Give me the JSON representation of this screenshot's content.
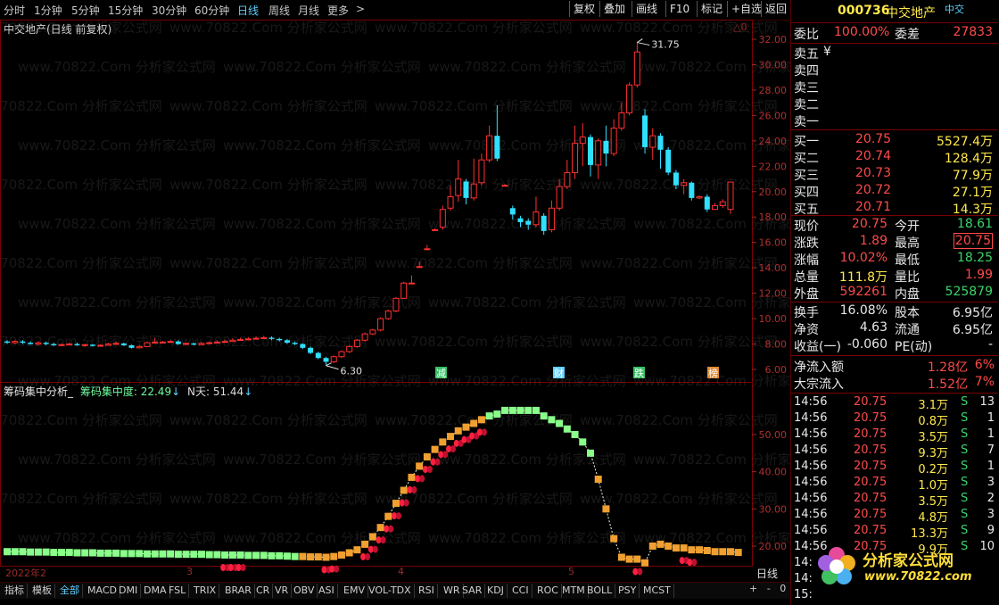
{
  "toolbar": {
    "periods": [
      "分时",
      "1分钟",
      "5分钟",
      "15分钟",
      "30分钟",
      "60分钟",
      "日线",
      "周线",
      "月线",
      "更多"
    ],
    "active_period": "日线",
    "more_arrow": ">",
    "buttons": [
      "复权",
      "叠加",
      "画线",
      "F10",
      "标记",
      "+自选",
      "返回"
    ]
  },
  "chart": {
    "title": "中交地产(日线 前复权)",
    "high_label": "31.75",
    "low_label": "6.30",
    "axis_ticks": [
      "32.00",
      "30.00",
      "28.00",
      "26.00",
      "24.00",
      "22.00",
      "20.00",
      "18.00",
      "16.00",
      "14.00",
      "12.00",
      "10.00",
      "8.00",
      "6.00"
    ],
    "events": [
      {
        "text": "减",
        "color": "#35c065"
      },
      {
        "text": "财",
        "color": "#5fd0ff"
      },
      {
        "text": "跌",
        "color": "#35c065"
      },
      {
        "text": "榜",
        "color": "#e08a30"
      }
    ],
    "top_right_mark": "△0",
    "watermark": "www.70822.Com 分析家公式网"
  },
  "indicator": {
    "name": "筹码集中分析_",
    "label1": "筹码集中度:",
    "value1": "22.49",
    "label2": "N天:",
    "value2": "51.44",
    "axis_ticks": [
      "50.00",
      "40.00",
      "30.00",
      "20.00"
    ]
  },
  "xaxis": {
    "labels": [
      {
        "text": "2022年2",
        "pos": "left"
      },
      {
        "text": "3",
        "pos": "m3"
      },
      {
        "text": "4",
        "pos": "m4"
      },
      {
        "text": "5",
        "pos": "m5"
      }
    ],
    "period_label": "日线",
    "zoom_buttons": [
      "+",
      "-",
      "0"
    ]
  },
  "tabs": [
    "指标",
    "模板",
    "全部",
    "MACD",
    "DMI",
    "DMA",
    "FSL",
    "TRIX",
    "BRAR",
    "CR",
    "VR",
    "OBV",
    "ASI",
    "EMV",
    "VOL-TDX",
    "RSI",
    "WR",
    "SAR",
    "KDJ",
    "CCI",
    "ROC",
    "MTM",
    "BOLL",
    "PSY",
    "MCST"
  ],
  "active_tab": "全部",
  "quote": {
    "code": "000736",
    "name": "中交地产",
    "short": "中交",
    "weibi_label": "委比",
    "weibi": "100.00%",
    "weicha_label": "委差",
    "weicha": "27833",
    "sell": [
      {
        "label": "卖五",
        "price": "¥",
        "vol": ""
      },
      {
        "label": "卖四",
        "price": "",
        "vol": ""
      },
      {
        "label": "卖三",
        "price": "",
        "vol": ""
      },
      {
        "label": "卖二",
        "price": "",
        "vol": ""
      },
      {
        "label": "卖一",
        "price": "",
        "vol": ""
      }
    ],
    "buy": [
      {
        "label": "买一",
        "price": "20.75",
        "vol": "5527.4万"
      },
      {
        "label": "买二",
        "price": "20.74",
        "vol": "128.4万"
      },
      {
        "label": "买三",
        "price": "20.73",
        "vol": "77.9万"
      },
      {
        "label": "买四",
        "price": "20.72",
        "vol": "27.1万"
      },
      {
        "label": "买五",
        "price": "20.71",
        "vol": "14.3万"
      }
    ],
    "stats": [
      {
        "l1": "现价",
        "v1": "20.75",
        "c1": "red",
        "l2": "今开",
        "v2": "18.61",
        "c2": "green"
      },
      {
        "l1": "涨跌",
        "v1": "1.89",
        "c1": "red",
        "l2": "最高",
        "v2": "20.75",
        "c2": "red"
      },
      {
        "l1": "涨幅",
        "v1": "10.02%",
        "c1": "red",
        "l2": "最低",
        "v2": "18.25",
        "c2": "green"
      },
      {
        "l1": "总量",
        "v1": "111.8万",
        "c1": "yellow",
        "l2": "量比",
        "v2": "1.99",
        "c2": "red"
      },
      {
        "l1": "外盘",
        "v1": "592261",
        "c1": "red",
        "l2": "内盘",
        "v2": "525879",
        "c2": "green"
      }
    ],
    "stats2": [
      {
        "l1": "换手",
        "v1": "16.08%",
        "c1": "white",
        "l2": "股本",
        "v2": "6.95亿",
        "c2": "white"
      },
      {
        "l1": "净资",
        "v1": "4.63",
        "c1": "white",
        "l2": "流通",
        "v2": "6.95亿",
        "c2": "white"
      },
      {
        "l1": "收益(一)",
        "v1": "-0.060",
        "c1": "white",
        "l2": "PE(动)",
        "v2": "-",
        "c2": "white"
      }
    ],
    "flows": [
      {
        "label": "净流入额",
        "value": "1.28亿",
        "pct": "6%"
      },
      {
        "label": "大宗流入",
        "value": "1.52亿",
        "pct": "7%"
      }
    ],
    "ticks": [
      {
        "t": "14:56",
        "p": "20.75",
        "v": "3.1万",
        "s": "S",
        "n": "13"
      },
      {
        "t": "14:56",
        "p": "20.75",
        "v": "0.8万",
        "s": "S",
        "n": "1"
      },
      {
        "t": "14:56",
        "p": "20.75",
        "v": "3.5万",
        "s": "S",
        "n": "1"
      },
      {
        "t": "14:56",
        "p": "20.75",
        "v": "9.3万",
        "s": "S",
        "n": "7"
      },
      {
        "t": "14:56",
        "p": "20.75",
        "v": "0.2万",
        "s": "S",
        "n": "1"
      },
      {
        "t": "14:56",
        "p": "20.75",
        "v": "1.0万",
        "s": "S",
        "n": "3"
      },
      {
        "t": "14:56",
        "p": "20.75",
        "v": "3.5万",
        "s": "S",
        "n": "2"
      },
      {
        "t": "14:56",
        "p": "20.75",
        "v": "4.8万",
        "s": "S",
        "n": "3"
      },
      {
        "t": "14:56",
        "p": "20.75",
        "v": "13.3万",
        "s": "S",
        "n": "9"
      },
      {
        "t": "14:56",
        "p": "20.75",
        "v": "9.9万",
        "s": "S",
        "n": "10"
      },
      {
        "t": "14:",
        "p": "",
        "v": "",
        "s": "",
        "n": ""
      },
      {
        "t": "14:",
        "p": "",
        "v": "",
        "s": "",
        "n": ""
      },
      {
        "t": "15:",
        "p": "",
        "v": "",
        "s": "",
        "n": ""
      }
    ],
    "logo_text": "分析家公式网",
    "logo_url": "www.70822.com"
  }
}
